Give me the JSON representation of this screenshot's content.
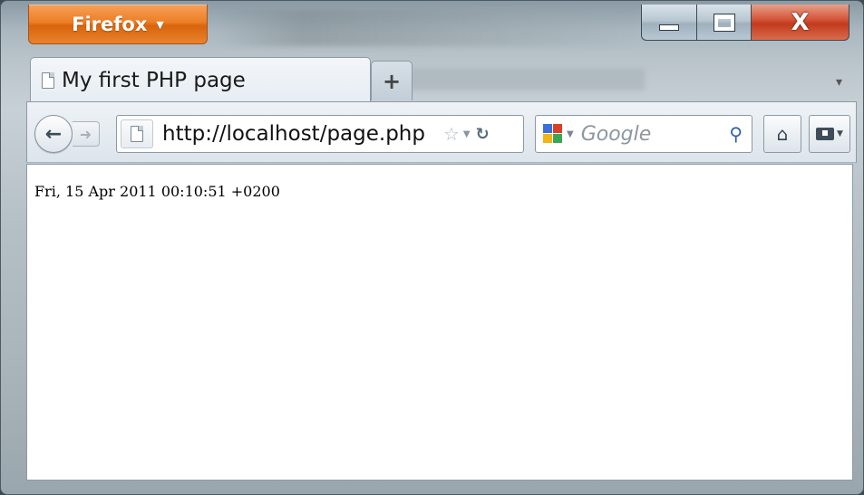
{
  "window": {
    "app_button_label": "Firefox",
    "controls": {
      "minimize": "minimize",
      "maximize": "maximize",
      "close": "X"
    }
  },
  "tabs": [
    {
      "title": "My first PHP page",
      "active": true
    }
  ],
  "new_tab_label": "+",
  "toolbar": {
    "url": "http://localhost/page.php",
    "search_engine": "Google",
    "search_placeholder": "Google"
  },
  "page": {
    "body_text": "Fri, 15 Apr 2011 00:10:51 +0200"
  },
  "colors": {
    "firefox_button": "#ec7f26",
    "close_button": "#c23a1e",
    "content_background": "#ffffff"
  }
}
